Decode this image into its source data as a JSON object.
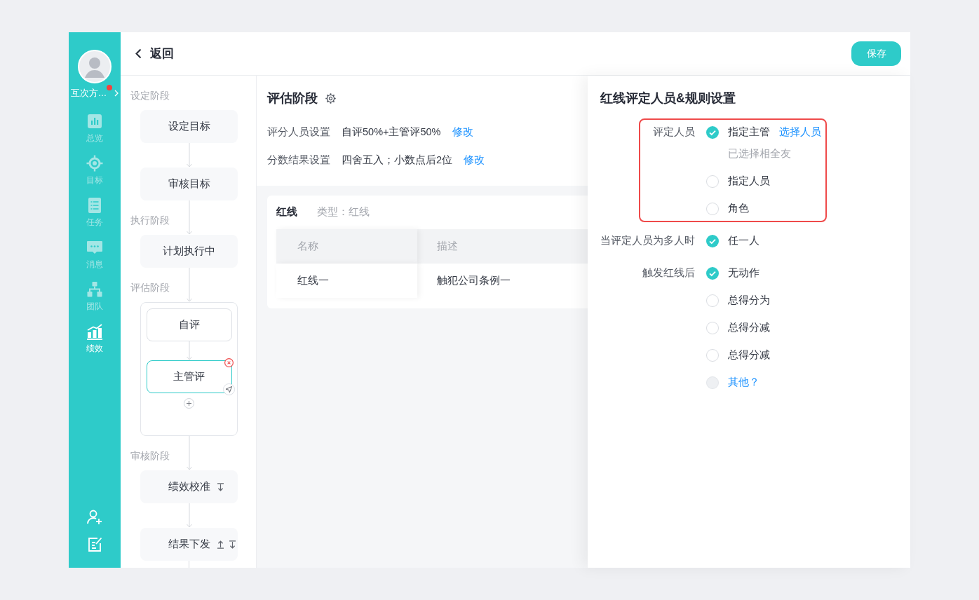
{
  "sidebar": {
    "user": {
      "name": "互次方…",
      "unread": true
    },
    "nav": [
      {
        "label": "总览",
        "selected": false
      },
      {
        "label": "目标",
        "selected": false
      },
      {
        "label": "任务",
        "selected": false
      },
      {
        "label": "消息",
        "selected": false
      },
      {
        "label": "团队",
        "selected": false
      },
      {
        "label": "绩效",
        "selected": true
      }
    ]
  },
  "header": {
    "back": "返回",
    "save": "保存"
  },
  "flow": [
    {
      "stage": "设定阶段",
      "nodes": [
        {
          "label": "设定目标",
          "move_up": false,
          "move_down": false
        },
        {
          "label": "审核目标",
          "move_up": false,
          "move_down": false
        }
      ]
    },
    {
      "stage": "执行阶段",
      "nodes": [
        {
          "label": "计划执行中",
          "move_up": false,
          "move_down": false
        }
      ]
    },
    {
      "stage": "评估阶段",
      "group": [
        {
          "label": "自评",
          "selected": false
        },
        {
          "label": "主管评",
          "selected": true
        }
      ]
    },
    {
      "stage": "审核阶段",
      "nodes": [
        {
          "label": "绩效校准",
          "move_up": false,
          "move_down": true
        },
        {
          "label": "结果下发",
          "move_up": true,
          "move_down": true
        }
      ]
    }
  ],
  "stage": {
    "title": "评估阶段",
    "settings": [
      {
        "label": "评分人员设置",
        "value": "自评50%+主管评50%",
        "action": "修改"
      },
      {
        "label": "分数结果设置",
        "value": "四舍五入；小数点后2位",
        "action": "修改"
      }
    ]
  },
  "redline": {
    "title": "红线",
    "type": "类型：红线",
    "columns": [
      "名称",
      "描述"
    ],
    "rows": [
      [
        "红线一",
        "触犯公司条例一"
      ]
    ]
  },
  "drawer": {
    "title": "红线评定人员&规则设置",
    "fields": [
      {
        "label": "评定人员",
        "highlighted": true,
        "options": [
          {
            "kind": "option",
            "label": "指定主管",
            "checked": true,
            "link": "选择人员",
            "note": "已选择相全友"
          },
          {
            "kind": "option",
            "label": "指定人员",
            "checked": false
          },
          {
            "kind": "option",
            "label": "角色",
            "checked": false
          }
        ]
      },
      {
        "label": "当评定人员为多人时",
        "highlighted": false,
        "options": [
          {
            "kind": "option",
            "label": "任一人",
            "checked": true
          }
        ]
      },
      {
        "label": "触发红线后",
        "highlighted": false,
        "options": [
          {
            "kind": "option",
            "label": "无动作",
            "checked": true
          },
          {
            "kind": "option",
            "label": "总得分为",
            "checked": false
          },
          {
            "kind": "option",
            "label": "总得分减",
            "checked": false
          },
          {
            "kind": "option",
            "label": "总得分减",
            "checked": false
          },
          {
            "kind": "custom",
            "label": "其他？",
            "checked": false
          }
        ]
      }
    ]
  }
}
